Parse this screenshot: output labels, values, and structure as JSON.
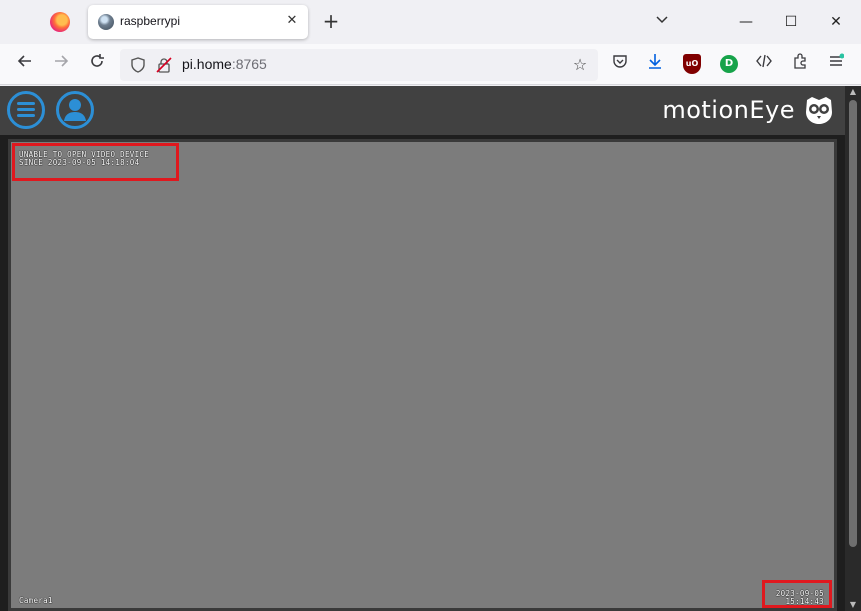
{
  "browser": {
    "tab_title": "raspberrypi",
    "tab_close": "✕",
    "new_tab": "+",
    "url_host": "pi.home",
    "url_port": ":8765",
    "window_controls": {
      "minimize": "—",
      "maximize": "☐",
      "close": "✕"
    },
    "toolbar_icons": [
      "back-icon",
      "forward-icon",
      "reload-icon",
      "shield-icon",
      "star-icon",
      "pocket-icon",
      "download-icon",
      "ublock-icon",
      "extension-icon",
      "devtools-icon",
      "extensions-icon",
      "menu-icon"
    ],
    "ublock_label": "uO",
    "ext_label": "D"
  },
  "app": {
    "title": "motionEye"
  },
  "camera": {
    "status_line1": "UNABLE TO OPEN VIDEO DEVICE",
    "status_line2": "SINCE 2023-09-05 14:18:04",
    "name": "Camera1",
    "date": "2023-09-05",
    "time": "15:14:43"
  },
  "colors": {
    "accent": "#2c8fd6",
    "highlight": "#e0181e",
    "frame": "#7c7c7c",
    "header": "#414141"
  }
}
